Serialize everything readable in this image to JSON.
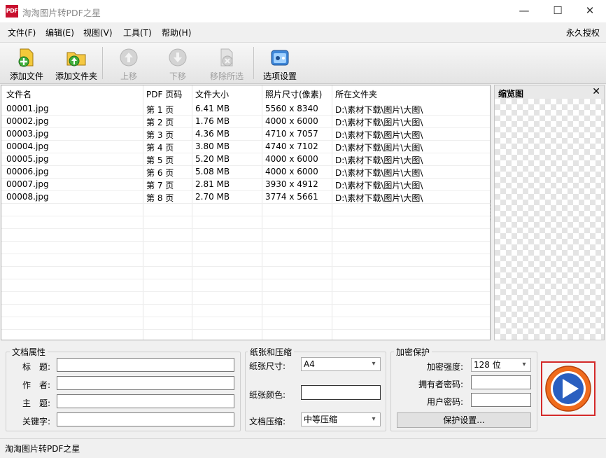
{
  "window": {
    "icon_text": "PDF",
    "title": "淘淘图片转PDF之星",
    "controls": [
      "—",
      "☐",
      "✕"
    ]
  },
  "menu": {
    "items": [
      "文件(F)",
      "编辑(E)",
      "视图(V)",
      "工具(T)",
      "帮助(H)"
    ],
    "right_item": "永久授权"
  },
  "toolbar": {
    "add_file": "添加文件",
    "add_folder": "添加文件夹",
    "move_up": "上移",
    "move_down": "下移",
    "remove_selected": "移除所选",
    "options": "选项设置"
  },
  "table": {
    "headers": [
      "文件名",
      "PDF 页码",
      "文件大小",
      "照片尺寸(像素)",
      "所在文件夹"
    ],
    "rows": [
      [
        "00001.jpg",
        "第 1 页",
        "6.41 MB",
        "5560 x 8340",
        "D:\\素材下载\\图片\\大图\\"
      ],
      [
        "00002.jpg",
        "第 2 页",
        "1.76 MB",
        "4000 x 6000",
        "D:\\素材下载\\图片\\大图\\"
      ],
      [
        "00003.jpg",
        "第 3 页",
        "4.36 MB",
        "4710 x 7057",
        "D:\\素材下载\\图片\\大图\\"
      ],
      [
        "00004.jpg",
        "第 4 页",
        "3.80 MB",
        "4740 x 7102",
        "D:\\素材下载\\图片\\大图\\"
      ],
      [
        "00005.jpg",
        "第 5 页",
        "5.20 MB",
        "4000 x 6000",
        "D:\\素材下载\\图片\\大图\\"
      ],
      [
        "00006.jpg",
        "第 6 页",
        "5.08 MB",
        "4000 x 6000",
        "D:\\素材下载\\图片\\大图\\"
      ],
      [
        "00007.jpg",
        "第 7 页",
        "2.81 MB",
        "3930 x 4912",
        "D:\\素材下载\\图片\\大图\\"
      ],
      [
        "00008.jpg",
        "第 8 页",
        "2.70 MB",
        "3774 x 5661",
        "D:\\素材下载\\图片\\大图\\"
      ]
    ]
  },
  "thumbnail": {
    "title": "缩览图",
    "close": "✕"
  },
  "doc_props": {
    "legend": "文档属性",
    "title_label": "标　题:",
    "author_label": "作　者:",
    "subject_label": "主　题:",
    "keywords_label": "关键字:",
    "title_value": "",
    "author_value": "",
    "subject_value": "",
    "keywords_value": ""
  },
  "paper": {
    "legend": "纸张和压缩",
    "size_label": "纸张尺寸:",
    "size_value": "A4",
    "color_label": "纸张颜色:",
    "compress_label": "文档压缩:",
    "compress_value": "中等压缩"
  },
  "security": {
    "legend": "加密保护",
    "strength_label": "加密强度:",
    "strength_value": "128 位",
    "owner_pw_label": "拥有者密码:",
    "user_pw_label": "用户密码:",
    "protect_button": "保护设置..."
  },
  "status_bar": {
    "text": "淘淘图片转PDF之星"
  },
  "colors": {
    "start_border": "#d42a2a",
    "start_ring": "#ef6b1c",
    "start_center": "#2a5fc0"
  }
}
